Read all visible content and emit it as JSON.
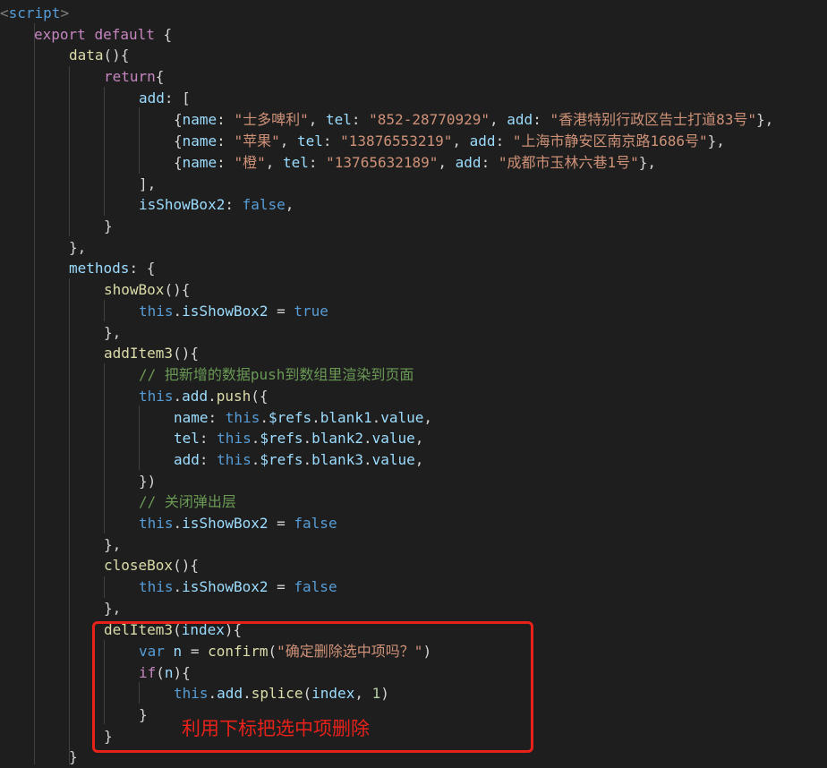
{
  "code": {
    "open_tag_bracket": "<",
    "open_tag_name": "script",
    "open_tag_close": ">",
    "export_kw": "export",
    "default_kw": "default",
    "data_fn": "data",
    "return_kw": "return",
    "add_key": "add",
    "items": [
      {
        "name": "\"士多啤利\"",
        "tel": "\"852-28770929\"",
        "add": "\"香港特别行政区告士打道83号\""
      },
      {
        "name": "\"苹果\"",
        "tel": "\"13876553219\"",
        "add": "\"上海市静安区南京路1686号\""
      },
      {
        "name": "\"橙\"",
        "tel": "\"13765632189\"",
        "add": "\"成都市玉林六巷1号\""
      }
    ],
    "name_key": "name",
    "tel_key": "tel",
    "is_show_key": "isShowBox2",
    "false_kw": "false",
    "true_kw": "true",
    "methods_key": "methods",
    "showbox_fn": "showBox",
    "this_kw": "this",
    "additem3_fn": "addItem3",
    "comment_push": "// 把新增的数据push到数组里渲染到页面",
    "push_fn": "push",
    "refs_prop": "$refs",
    "blank1": "blank1",
    "blank2": "blank2",
    "blank3": "blank3",
    "value_prop": "value",
    "comment_close": "// 关闭弹出层",
    "closebox_fn": "closeBox",
    "delitem3_fn": "delItem3",
    "index_param": "index",
    "var_kw": "var",
    "n_var": "n",
    "confirm_fn": "confirm",
    "confirm_msg": "\"确定删除选中项吗？\"",
    "if_kw": "if",
    "splice_fn": "splice",
    "one_num": "1"
  },
  "annotation": "利用下标把选中项删除",
  "colors": {
    "background": "#1e1e1e",
    "annotation_red": "#e8221b"
  }
}
